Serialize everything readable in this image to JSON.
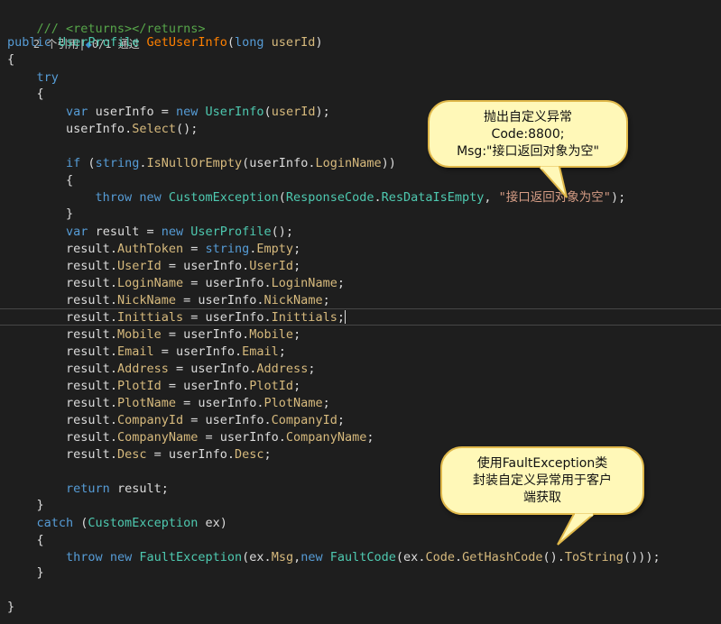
{
  "code": {
    "comment_top": "/// <returns></returns>",
    "codelens": {
      "refs": "2 个引用|",
      "tests": "0/1 通过"
    },
    "sig": {
      "kw": "public",
      "ret": "UserProfile",
      "name": "GetUserInfo",
      "ptype": "long",
      "pname": "userId"
    },
    "brace_open": "{",
    "brace_close": "}",
    "try_kw": "try",
    "var_kw": "var",
    "new_kw": "new",
    "if_kw": "if",
    "throw_kw": "throw",
    "return_kw": "return",
    "catch_kw": "catch",
    "string_kw": "string",
    "local_userinfo": "userInfo",
    "local_result": "result",
    "local_ex": "ex",
    "type_userinfo": "UserInfo",
    "type_userprofile": "UserProfile",
    "type_customex": "CustomException",
    "type_faultex": "FaultException",
    "type_faultcode": "FaultCode",
    "type_responsecode": "ResponseCode",
    "method_select": "Select",
    "method_isnull": "IsNullOrEmpty",
    "method_gethash": "GetHashCode",
    "method_tostring": "ToString",
    "prop_loginname": "LoginName",
    "prop_resdataisempty": "ResDataIsEmpty",
    "prop_empty": "Empty",
    "prop_msg": "Msg",
    "prop_code": "Code",
    "str_msg": "\"接口返回对象为空\"",
    "assignments": [
      {
        "left": "AuthToken",
        "right": null
      },
      {
        "left": "UserId",
        "right": "UserId"
      },
      {
        "left": "LoginName",
        "right": "LoginName"
      },
      {
        "left": "NickName",
        "right": "NickName"
      },
      {
        "left": "Inittials",
        "right": "Inittials"
      },
      {
        "left": "Mobile",
        "right": "Mobile"
      },
      {
        "left": "Email",
        "right": "Email"
      },
      {
        "left": "Address",
        "right": "Address"
      },
      {
        "left": "PlotId",
        "right": "PlotId"
      },
      {
        "left": "PlotName",
        "right": "PlotName"
      },
      {
        "left": "CompanyId",
        "right": "CompanyId"
      },
      {
        "left": "CompanyName",
        "right": "CompanyName"
      },
      {
        "left": "Desc",
        "right": "Desc"
      }
    ]
  },
  "callouts": {
    "top": {
      "line1": "抛出自定义异常",
      "line2": "Code:8800;",
      "line3": "Msg:\"接口返回对象为空\""
    },
    "bottom": {
      "line1": "使用FaultException类",
      "line2": "封装自定义异常用于客户",
      "line3": "端获取"
    }
  },
  "colors": {
    "background": "#1e1e1e",
    "keyword": "#569cd6",
    "type": "#4ec9b0",
    "method": "#dcdcaa",
    "property": "#d7ba7d",
    "string": "#d69d85",
    "comment": "#57a64a",
    "callout_fill": "#fff8b8",
    "callout_border": "#e0b84a"
  }
}
